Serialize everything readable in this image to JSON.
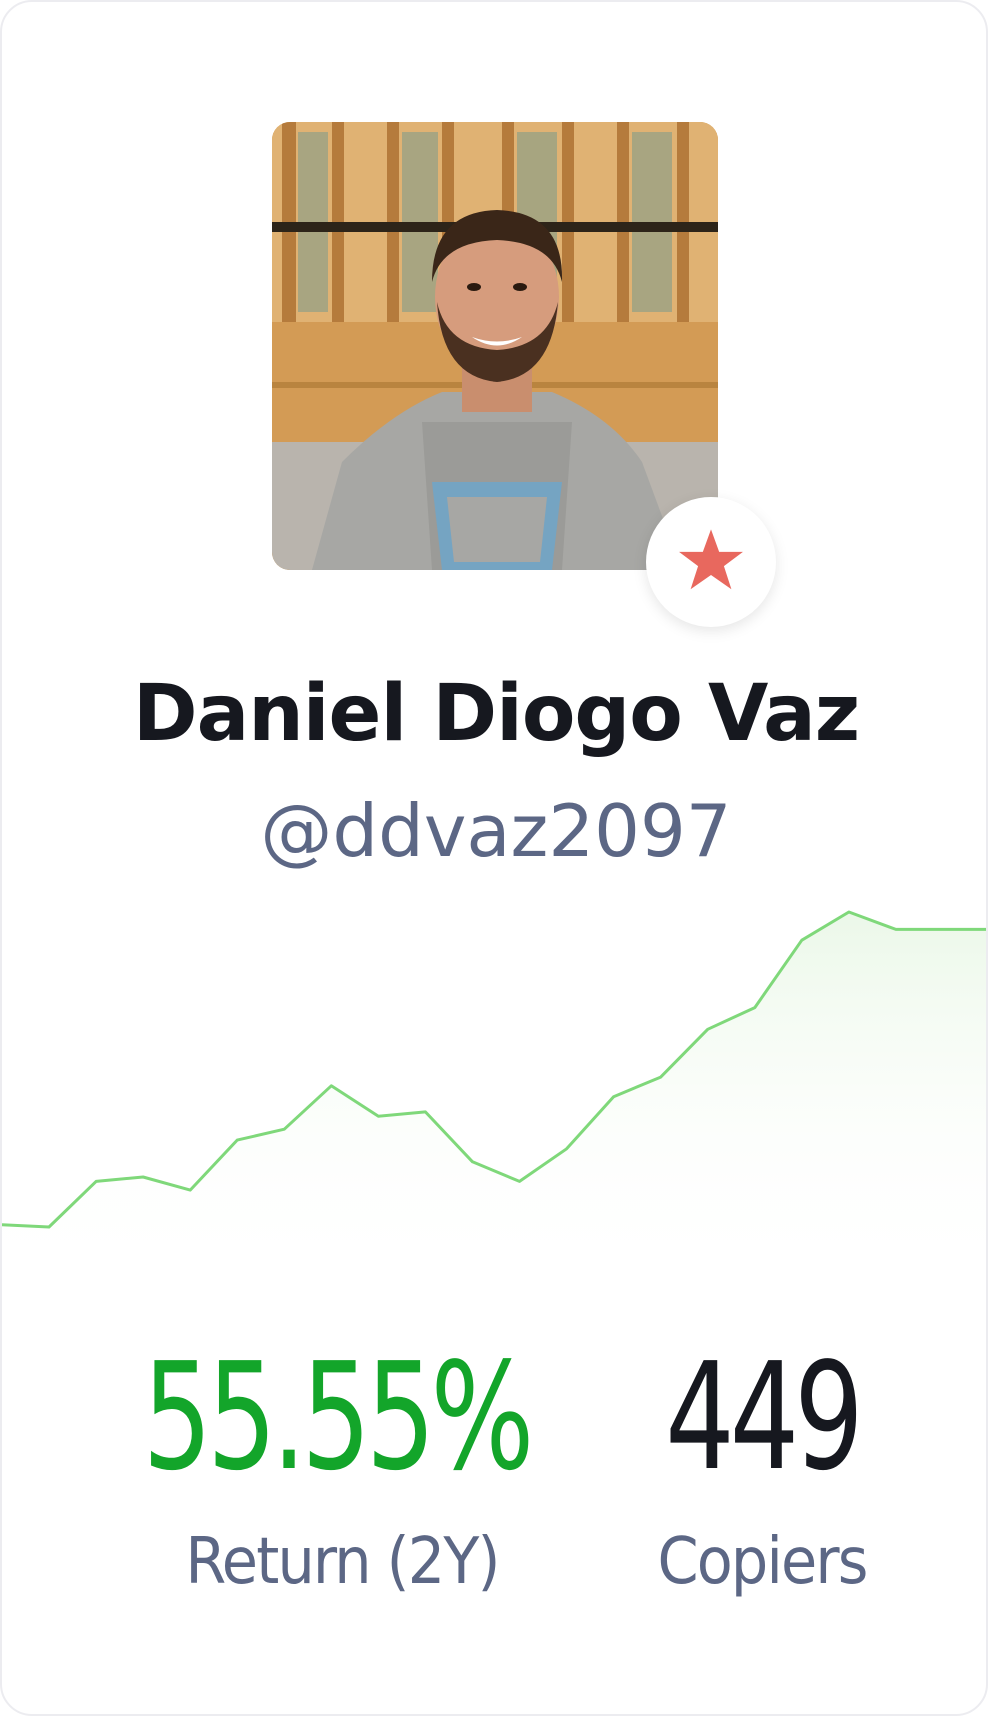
{
  "profile": {
    "name": "Daniel Diogo Vaz",
    "handle": "@ddvaz2097",
    "badge_icon": "star-icon",
    "badge_color": "#e8685e"
  },
  "chart_data": {
    "type": "area",
    "x": [
      0,
      1,
      2,
      3,
      4,
      5,
      6,
      7,
      8,
      9,
      10,
      11,
      12,
      13,
      14,
      15,
      16,
      17,
      18,
      19,
      20,
      21
    ],
    "series": [
      {
        "values": [
          0.0,
          -0.1,
          2.0,
          2.2,
          1.6,
          3.9,
          4.4,
          6.4,
          5.0,
          5.2,
          2.9,
          2.0,
          3.5,
          5.9,
          6.8,
          9.0,
          10.0,
          13.1,
          14.4,
          13.6,
          13.6,
          13.6
        ],
        "color": "#7fd87a"
      }
    ],
    "grid": false,
    "legend": "none"
  },
  "stats": {
    "return_value": "55.55%",
    "return_label": "Return (2Y)",
    "copiers_value": "449",
    "copiers_label": "Copiers",
    "positive_color": "#13a52a"
  }
}
